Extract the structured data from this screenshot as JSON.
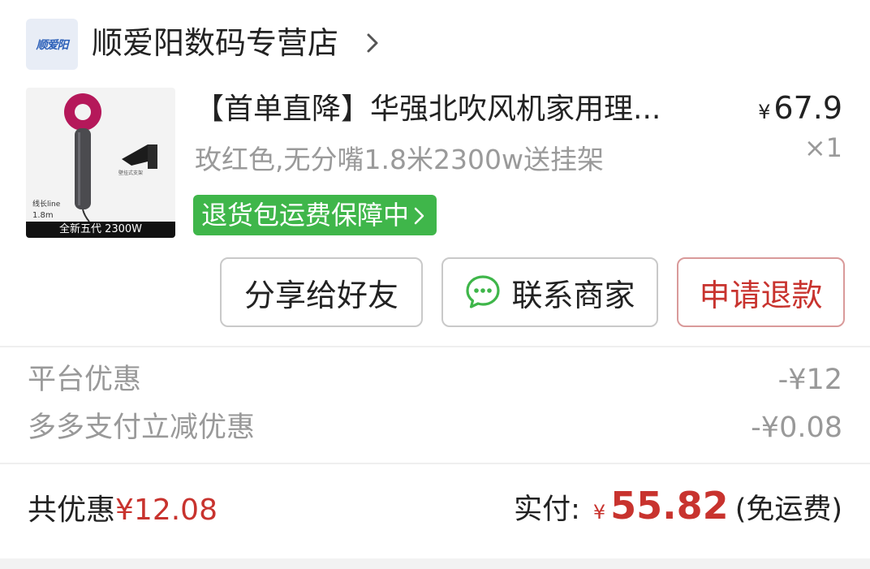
{
  "store": {
    "logo_text": "顺爱阳",
    "name": "顺爱阳数码专营店",
    "chevron_icon": "chevron-right-icon"
  },
  "product": {
    "image_caption": "全新五代  2300W",
    "image_spec_line1": "线长line",
    "image_spec_line2": "1.8m",
    "image_hanger_label": "壁挂式支架",
    "title": "【首单直降】华强北吹风机家用理...",
    "variant": "玫红色,无分嘴1.8米2300w送挂架",
    "return_badge": "退货包运费保障中",
    "price_symbol": "¥",
    "price": "67.9",
    "quantity": "×1"
  },
  "actions": {
    "share": "分享给好友",
    "contact": "联系商家",
    "refund": "申请退款"
  },
  "discounts": [
    {
      "label": "平台优惠",
      "value": "-¥12"
    },
    {
      "label": "多多支付立减优惠",
      "value": "-¥0.08"
    }
  ],
  "summary": {
    "total_discount_label": "共优惠",
    "total_discount_amount": "¥12.08",
    "paid_label": "实付:",
    "paid_symbol": "¥",
    "paid_amount": "55.82",
    "shipping_note": "(免运费)"
  },
  "colors": {
    "accent_red": "#c8332e",
    "badge_green": "#3fb64a",
    "muted_gray": "#999999",
    "chat_green": "#3fb64a"
  }
}
